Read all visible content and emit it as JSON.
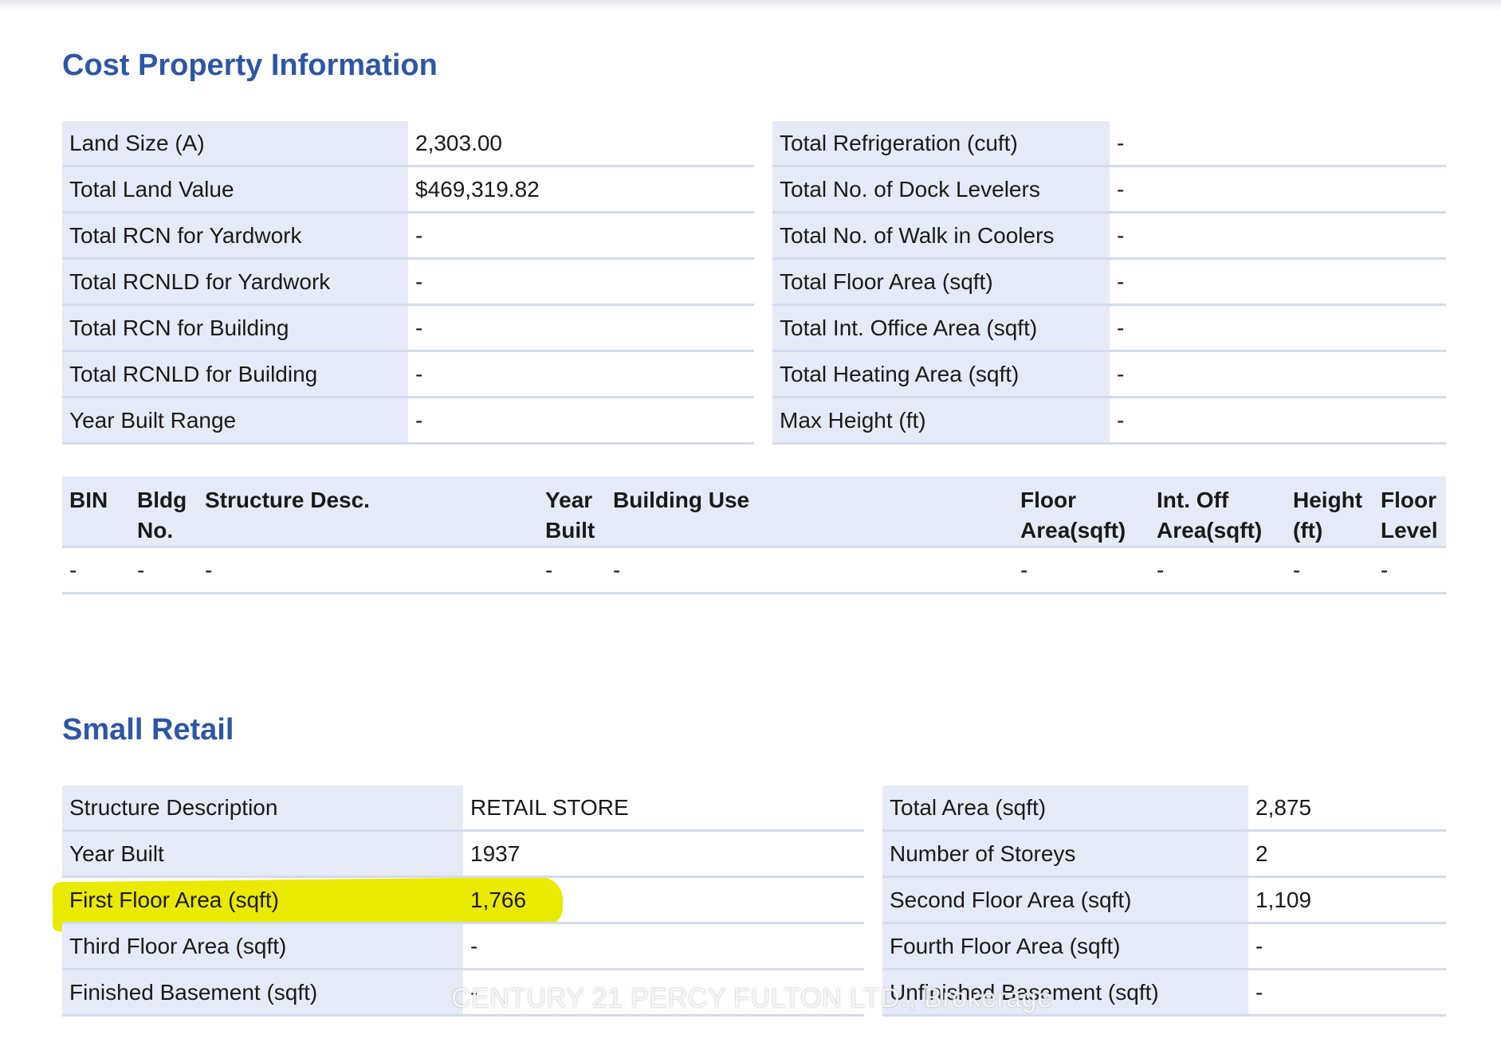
{
  "cost_property": {
    "title": "Cost Property Information",
    "left_rows": [
      {
        "label": "Land Size (A)",
        "value": "2,303.00"
      },
      {
        "label": "Total Land Value",
        "value": "$469,319.82"
      },
      {
        "label": "Total RCN for Yardwork",
        "value": "-"
      },
      {
        "label": "Total RCNLD for Yardwork",
        "value": "-"
      },
      {
        "label": "Total RCN for Building",
        "value": "-"
      },
      {
        "label": "Total RCNLD for Building",
        "value": "-"
      },
      {
        "label": "Year Built Range",
        "value": "-"
      }
    ],
    "right_rows": [
      {
        "label": "Total Refrigeration (cuft)",
        "value": "-"
      },
      {
        "label": "Total No. of Dock Levelers",
        "value": "-"
      },
      {
        "label": "Total No. of Walk in Coolers",
        "value": "-"
      },
      {
        "label": "Total Floor Area (sqft)",
        "value": "-"
      },
      {
        "label": "Total Int. Office Area (sqft)",
        "value": "-"
      },
      {
        "label": "Total Heating Area (sqft)",
        "value": "-"
      },
      {
        "label": "Max Height (ft)",
        "value": "-"
      }
    ]
  },
  "building_table": {
    "headers": [
      {
        "line1": "BIN",
        "line2": ""
      },
      {
        "line1": "Bldg",
        "line2": "No."
      },
      {
        "line1": "Structure Desc.",
        "line2": ""
      },
      {
        "line1": "Year",
        "line2": "Built"
      },
      {
        "line1": "Building Use",
        "line2": ""
      },
      {
        "line1": "Floor",
        "line2": "Area(sqft)"
      },
      {
        "line1": "Int. Off",
        "line2": "Area(sqft)"
      },
      {
        "line1": "Height",
        "line2": "(ft)"
      },
      {
        "line1": "Floor",
        "line2": "Level"
      }
    ],
    "rows": [
      [
        "-",
        "-",
        "-",
        "-",
        "-",
        "-",
        "-",
        "-",
        "-"
      ]
    ]
  },
  "small_retail": {
    "title": "Small Retail",
    "left_rows": [
      {
        "label": "Structure Description",
        "value": "RETAIL STORE"
      },
      {
        "label": "Year Built",
        "value": "1937"
      },
      {
        "label": "First Floor Area (sqft)",
        "value": "1,766",
        "highlighted": true
      },
      {
        "label": "Third Floor Area (sqft)",
        "value": "-"
      },
      {
        "label": "Finished Basement (sqft)",
        "value": "-"
      }
    ],
    "right_rows": [
      {
        "label": "Total Area (sqft)",
        "value": "2,875"
      },
      {
        "label": "Number of Storeys",
        "value": "2"
      },
      {
        "label": "Second Floor Area (sqft)",
        "value": "1,109"
      },
      {
        "label": "Fourth Floor Area (sqft)",
        "value": "-"
      },
      {
        "label": "Unfinished Basement (sqft)",
        "value": "-"
      }
    ]
  },
  "watermark": "CENTURY 21 PERCY FULTON LTD., Brokerage",
  "colors": {
    "heading": "#2e56a6",
    "label_bg": "#e6eaf6",
    "border": "#d5dbec",
    "highlight": "#eaea00"
  }
}
